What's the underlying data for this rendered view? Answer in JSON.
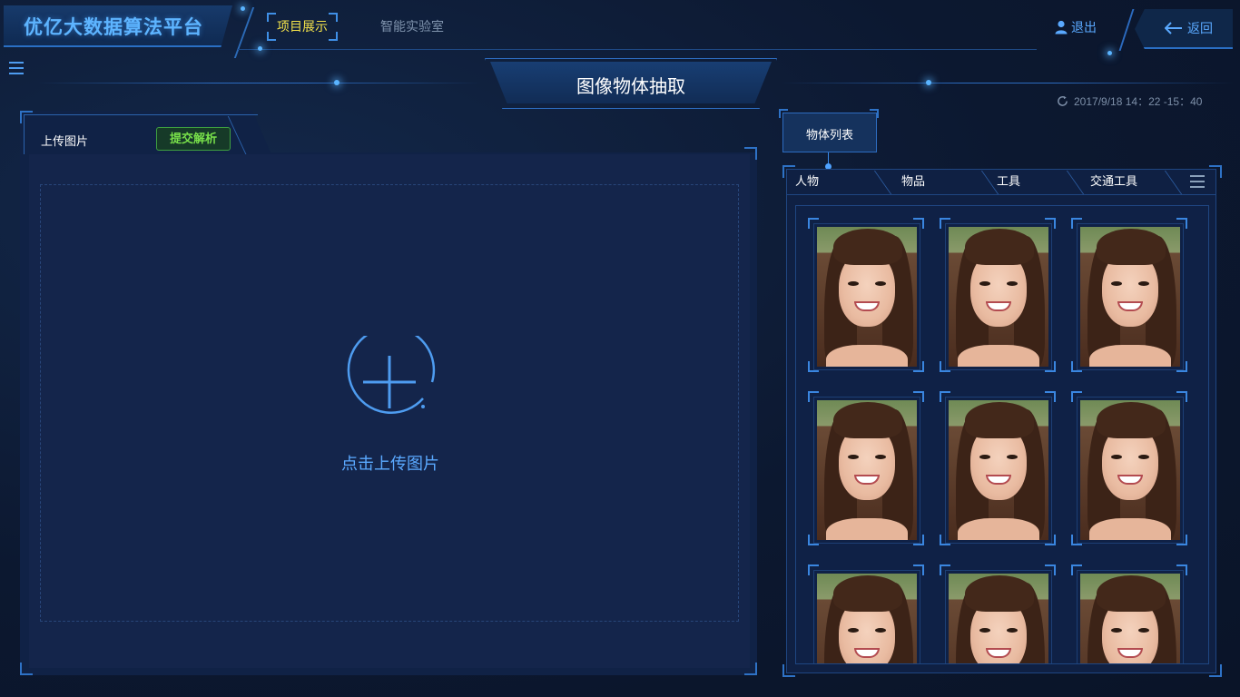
{
  "app": {
    "logo": "优亿大数据算法平台"
  },
  "nav": {
    "active": "项目展示",
    "items": [
      "智能实验室"
    ]
  },
  "header": {
    "logout": "退出",
    "back": "返回"
  },
  "page": {
    "title": "图像物体抽取",
    "timestamp": "2017/9/18  14：22  -15：40"
  },
  "left_panel": {
    "tab_label": "上传图片",
    "submit_label": "提交解析",
    "upload_text": "点击上传图片"
  },
  "right_panel": {
    "tab_label": "物体列表",
    "categories": [
      "人物",
      "物品",
      "工具",
      "交通工具"
    ],
    "photos_visible_count": 9
  },
  "colors": {
    "accent": "#5aa9ff",
    "nav_active": "#f3e24a",
    "submit_green": "#78e04a",
    "panel_bg": "#102246"
  },
  "icons": [
    "menu-icon",
    "user-icon",
    "back-arrow-icon",
    "refresh-icon",
    "plus-circle-icon",
    "list-menu-icon"
  ]
}
